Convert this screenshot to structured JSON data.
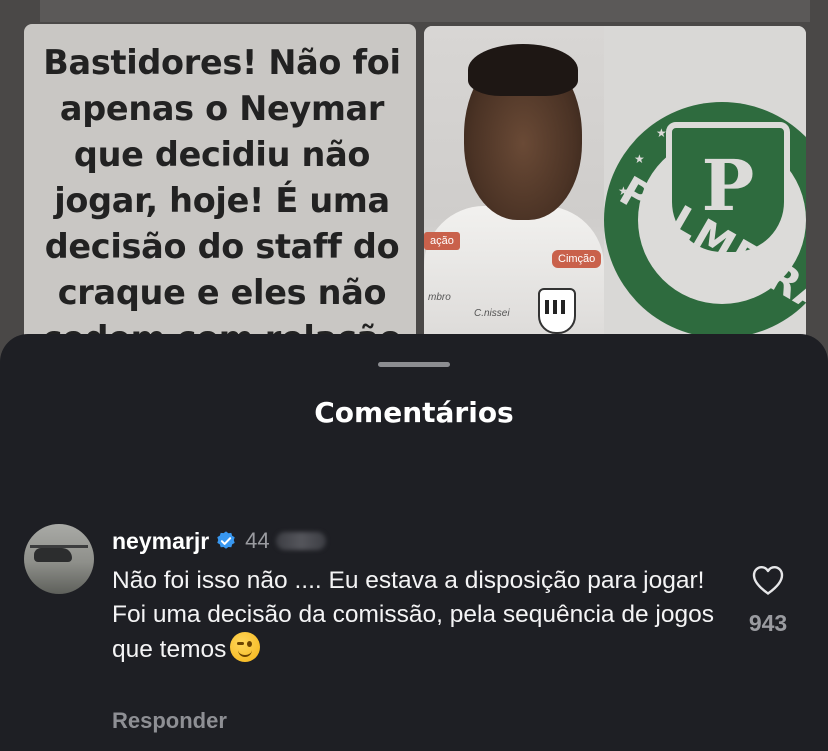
{
  "post": {
    "text_card": "Bastidores! Não foi apenas o Neymar que decidiu não jogar, hoje! É uma decisão do staff do craque e eles não cedem com relação",
    "image": {
      "sponsor_left": "ação",
      "sponsor_right": "Cimção",
      "shirt_brand": "mbro",
      "shirt_partner": "C.nissei",
      "crest_letter": "P",
      "crest_name": "PALMEIRAS"
    }
  },
  "sheet": {
    "title": "Comentários"
  },
  "comment": {
    "username": "neymarjr",
    "verified": true,
    "timestamp": "44",
    "text": "Não foi isso não .... Eu estava a disposição para jogar! Foi uma decisão da comissão, pela sequência de jogos que temos",
    "emoji_icon": "winking-face-emoji",
    "like_count": "943",
    "reply_label": "Responder"
  },
  "colors": {
    "sheet_background": "#1e1f24",
    "verified_badge": "#3897f0",
    "crest_green": "#2e6b3e"
  }
}
